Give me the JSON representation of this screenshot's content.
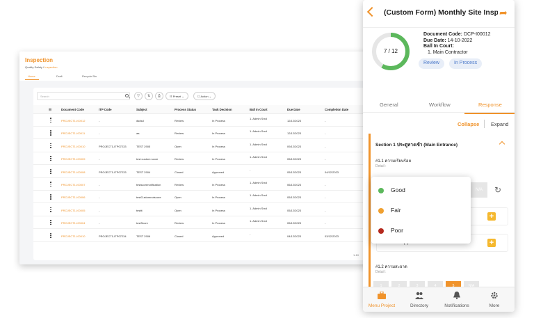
{
  "desktop": {
    "title": "Inspection",
    "breadcrumb_root": "Quality Safety",
    "breadcrumb_sep": " / ",
    "breadcrumb_current": "Inspection",
    "tabs": [
      "Home",
      "Draft",
      "Recycle Bin"
    ],
    "search_placeholder": "Search",
    "preset_label": "Preset",
    "action_label": "Action",
    "columns": [
      "Document Code",
      "ITP Code",
      "Subject",
      "Process Status",
      "Task Decision",
      "Ball In Court",
      "Due Date",
      "Completion Date"
    ],
    "rows": [
      {
        "code": "PROJECT1-I00012",
        "itp": "-",
        "subject": "dsdsd",
        "status": "Review",
        "decision": "In Process",
        "ball": "1. Admin Srxd",
        "due": "12/12/2023",
        "completion": "-"
      },
      {
        "code": "PROJECT1-I00011",
        "itp": "-",
        "subject": "aa",
        "status": "Review",
        "decision": "In Process",
        "ball": "1. Admin Srxd",
        "due": "12/12/2023",
        "completion": "-"
      },
      {
        "code": "PROJECT1-I00010",
        "itp": "PROJECT1-ITP07233",
        "subject": "TEST 2905",
        "status": "Open",
        "decision": "In Process",
        "ball": "1. Admin Srxd",
        "due": "09/12/2023",
        "completion": "-"
      },
      {
        "code": "PROJECT1-I00009",
        "itp": "-",
        "subject": "test custom score",
        "status": "Review",
        "decision": "In Process",
        "ball": "1. Admin Srxd",
        "due": "05/12/2023",
        "completion": "-"
      },
      {
        "code": "PROJECT1-I00008",
        "itp": "PROJECT1-ITP07233",
        "subject": "TEST 2904",
        "status": "Closed",
        "decision": "Approved",
        "ball": "-",
        "due": "05/12/2023",
        "completion": "04/12/2023"
      },
      {
        "code": "PROJECT1-I00007",
        "itp": "-",
        "subject": "testscorenotification",
        "status": "Review",
        "decision": "In Process",
        "ball": "1. Admin Srxd",
        "due": "06/12/2023",
        "completion": "-"
      },
      {
        "code": "PROJECT1-I00006",
        "itp": "-",
        "subject": "testCustomnotscore",
        "status": "Open",
        "decision": "In Process",
        "ball": "1. Admin Srxd",
        "due": "05/12/2023",
        "completion": "-"
      },
      {
        "code": "PROJECT1-I00005",
        "itp": "-",
        "subject": "testtt",
        "status": "Open",
        "decision": "In Process",
        "ball": "1. Admin Srxd",
        "due": "05/12/2023",
        "completion": "-"
      },
      {
        "code": "PROJECT1-I00004",
        "itp": "-",
        "subject": "testScore",
        "status": "Review",
        "decision": "In Process",
        "ball": "1. Admin Srxd",
        "due": "05/12/2023",
        "completion": "-"
      },
      {
        "code": "PROJECT1-I00010",
        "itp": "PROJECT1-ITP07234",
        "subject": "TEST 2906",
        "status": "Closed",
        "decision": "Approved",
        "ball": "-",
        "due": "04/12/2023",
        "completion": "03/12/2023"
      }
    ],
    "pager": "1-10"
  },
  "mobile": {
    "title": "(Custom Form) Monthly Site Inspect",
    "progress_text": "7 / 12",
    "progress_fraction": 0.583,
    "doc_code_label": "Document Code:",
    "doc_code": "DCP-I00012",
    "due_label": "Due Date:",
    "due": "14-10-2022",
    "ball_label": "Ball In Court:",
    "ball_value": "1. Main Contractor",
    "badges": [
      "Review",
      "In Process"
    ],
    "tabs": [
      "General",
      "Workflow",
      "Response"
    ],
    "collapse": "Collapse",
    "expand": "Expand",
    "section": "Section 1 ประตูทางเข้า (Main Entrance)",
    "q1": "#1.1 ความเรียบร้อย",
    "q1_detail": "Detail :",
    "na": "N/A",
    "comment_label": "Comment (0)",
    "q2": "#1.2 ความสะอาด",
    "q2_detail": "Detail :",
    "scores": [
      "1",
      "2",
      "3",
      "4",
      "5",
      "N/A"
    ],
    "selected_score": "5",
    "options": [
      {
        "label": "Good",
        "color": "#5cb85c"
      },
      {
        "label": "Fair",
        "color": "#f0a030"
      },
      {
        "label": "Poor",
        "color": "#b52a1e"
      }
    ],
    "nav": [
      "Menu Project",
      "Directory",
      "Notifications",
      "More"
    ],
    "accent": "#f0932b"
  }
}
